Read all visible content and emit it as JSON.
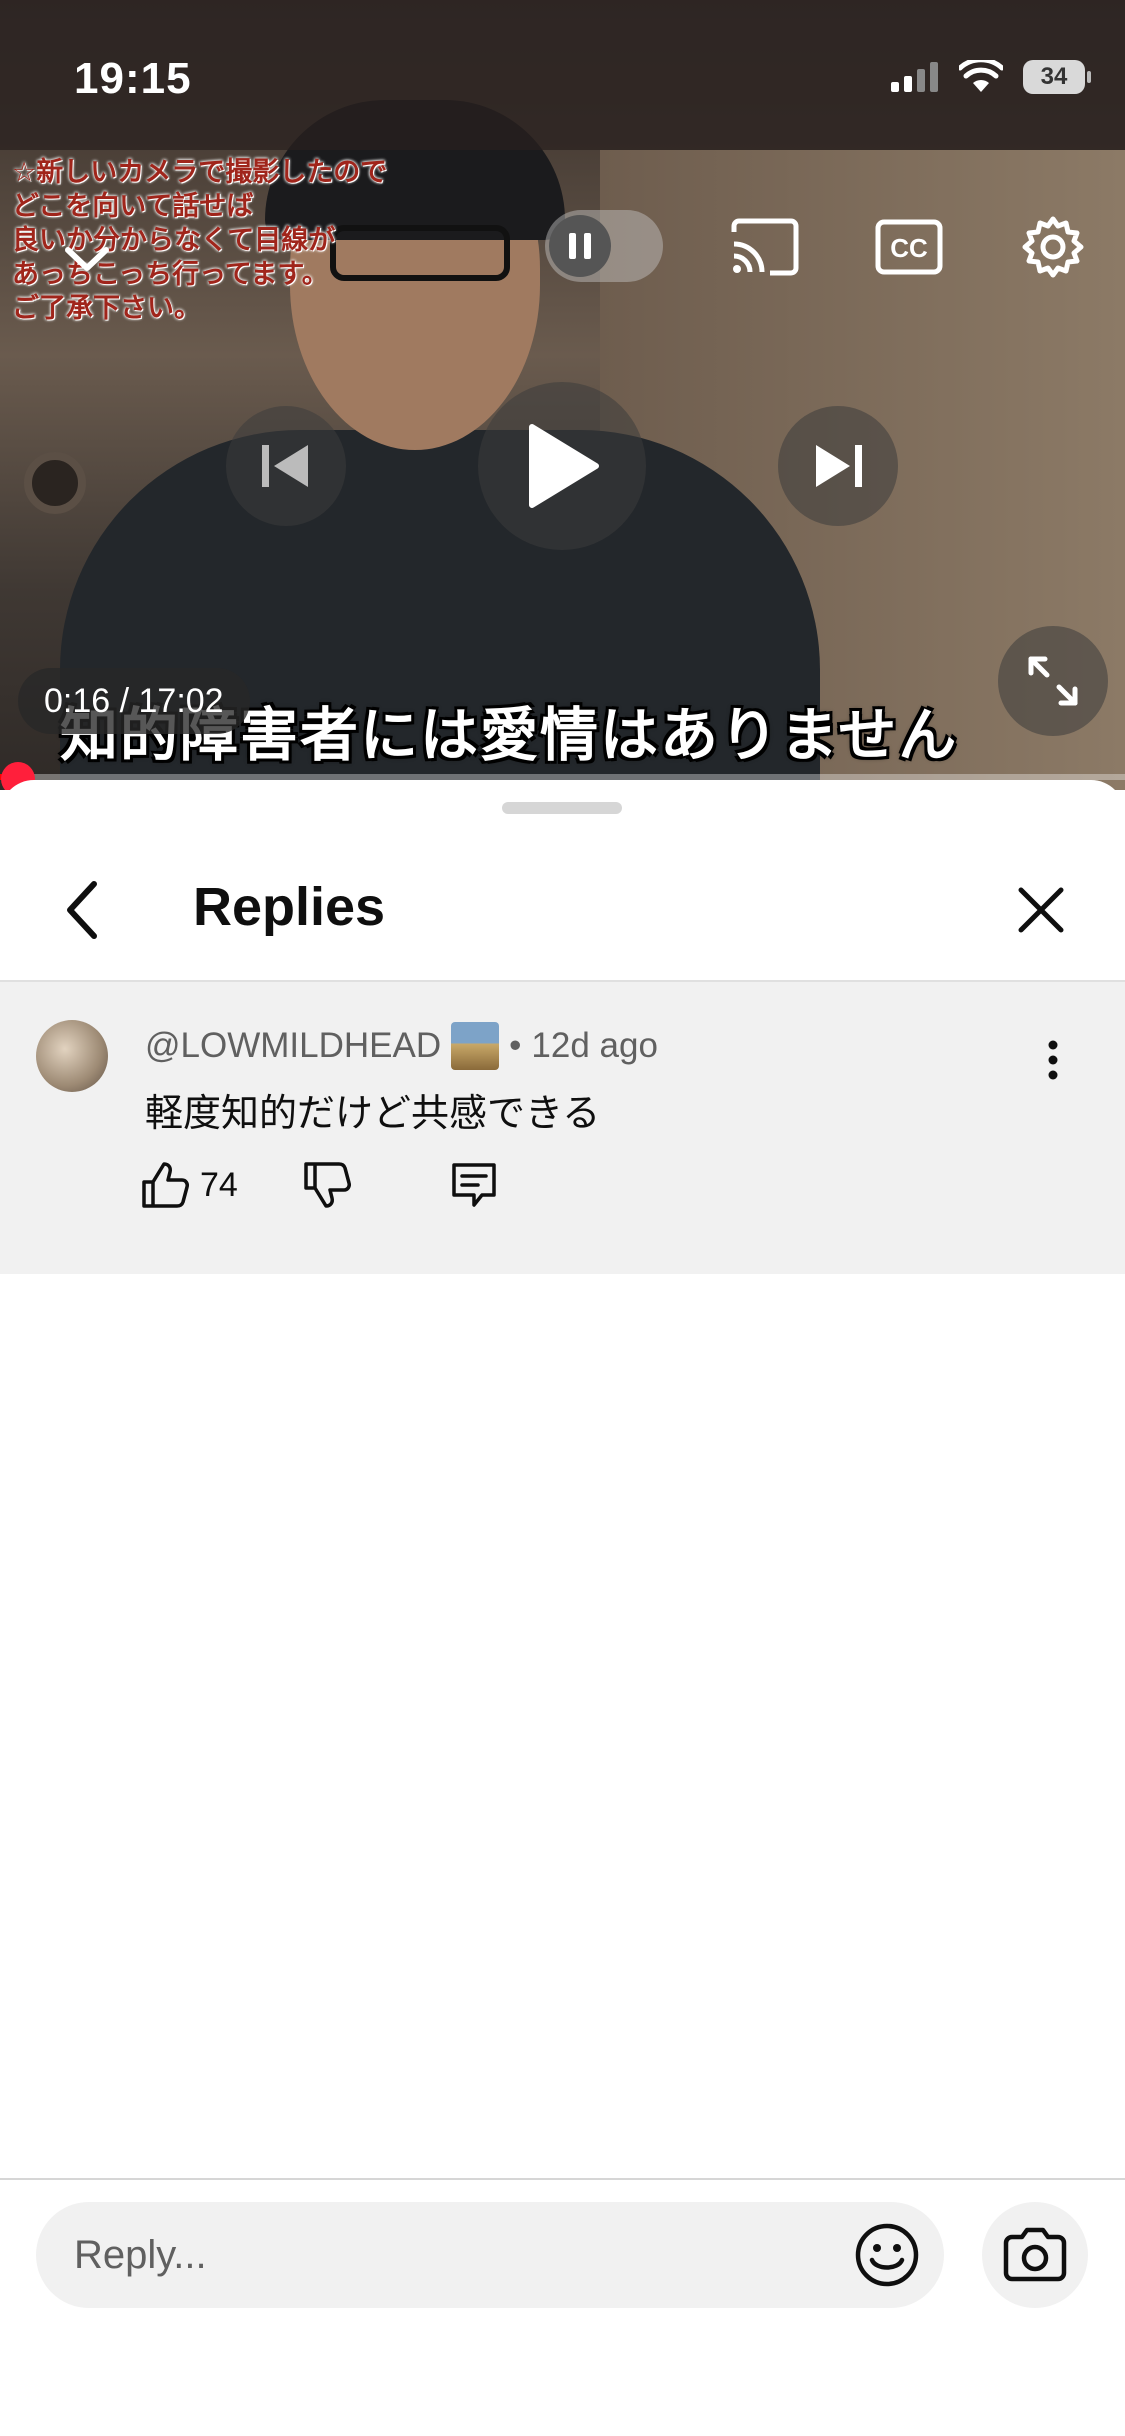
{
  "status_bar": {
    "time": "19:15",
    "battery": "34"
  },
  "video": {
    "overlay_text": "☆新しいカメラで撮影したので\nどこを向いて話せば\n良いか分からなくて目線が\nあっちこっち行ってます。\nご了承下さい。",
    "subtitle": "知的障害者には愛情はありません",
    "time_display": "0:16 / 17:02",
    "progress": 0.016,
    "controls": {
      "collapse_icon": "chevron-down-icon",
      "autoplay_icon": "pause-icon",
      "cast_icon": "cast-icon",
      "captions_icon": "cc-icon",
      "settings_icon": "gear-icon",
      "previous_icon": "skip-previous-icon",
      "play_icon": "play-icon",
      "next_icon": "skip-next-icon",
      "fullscreen_icon": "fullscreen-icon"
    }
  },
  "replies_panel": {
    "title": "Replies",
    "back_icon": "back-arrow-icon",
    "close_icon": "close-icon"
  },
  "comment": {
    "author": "@LOWMILDHEAD",
    "separator": "•",
    "age": "12d ago",
    "text": "軽度知的だけど共感できる",
    "like_count": "74"
  },
  "reply_bar": {
    "placeholder": "Reply...",
    "emoji_icon": "emoji-icon",
    "camera_icon": "camera-icon"
  },
  "colors": {
    "progress_red": "#ff0000",
    "comment_bg": "#f1f1f1",
    "text_primary": "#0f0f0f",
    "text_secondary": "#606060"
  }
}
